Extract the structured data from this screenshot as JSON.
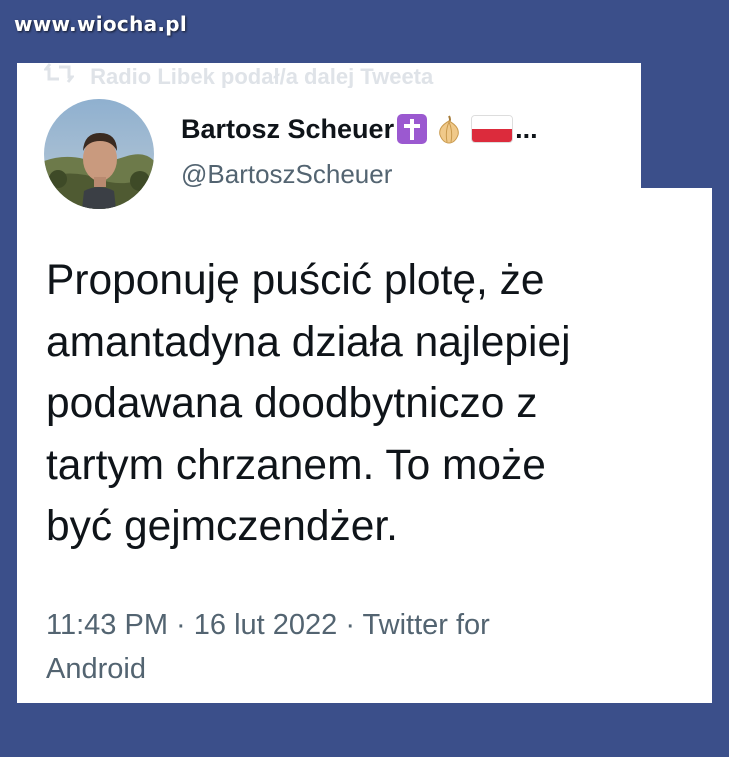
{
  "watermark": "www.wiocha.pl",
  "retweet_line": "Radio Libek podał/a dalej Tweeta",
  "author": {
    "display_name": "Bartosz Scheuer",
    "handle": "@BartoszScheuer",
    "name_suffix": "..."
  },
  "tweet": {
    "lines": [
      "Proponuję puścić plotę, że",
      "amantadyna działa najlepiej",
      "podawana doodbytniczo z",
      "tartym chrzanem. To może",
      "być gejmczendżer."
    ]
  },
  "meta": {
    "time": "11:43 PM",
    "separator": " · ",
    "date": "16 lut 2022",
    "source_line1": "Twitter for",
    "source_line2": "Android"
  },
  "colors": {
    "background": "#3b4f8a",
    "card": "#ffffff",
    "text": "#0f1419",
    "secondary": "#536471"
  },
  "icons": [
    "retweet-icon",
    "cross-emoji-icon",
    "onion-emoji-icon",
    "poland-flag-emoji-icon"
  ]
}
